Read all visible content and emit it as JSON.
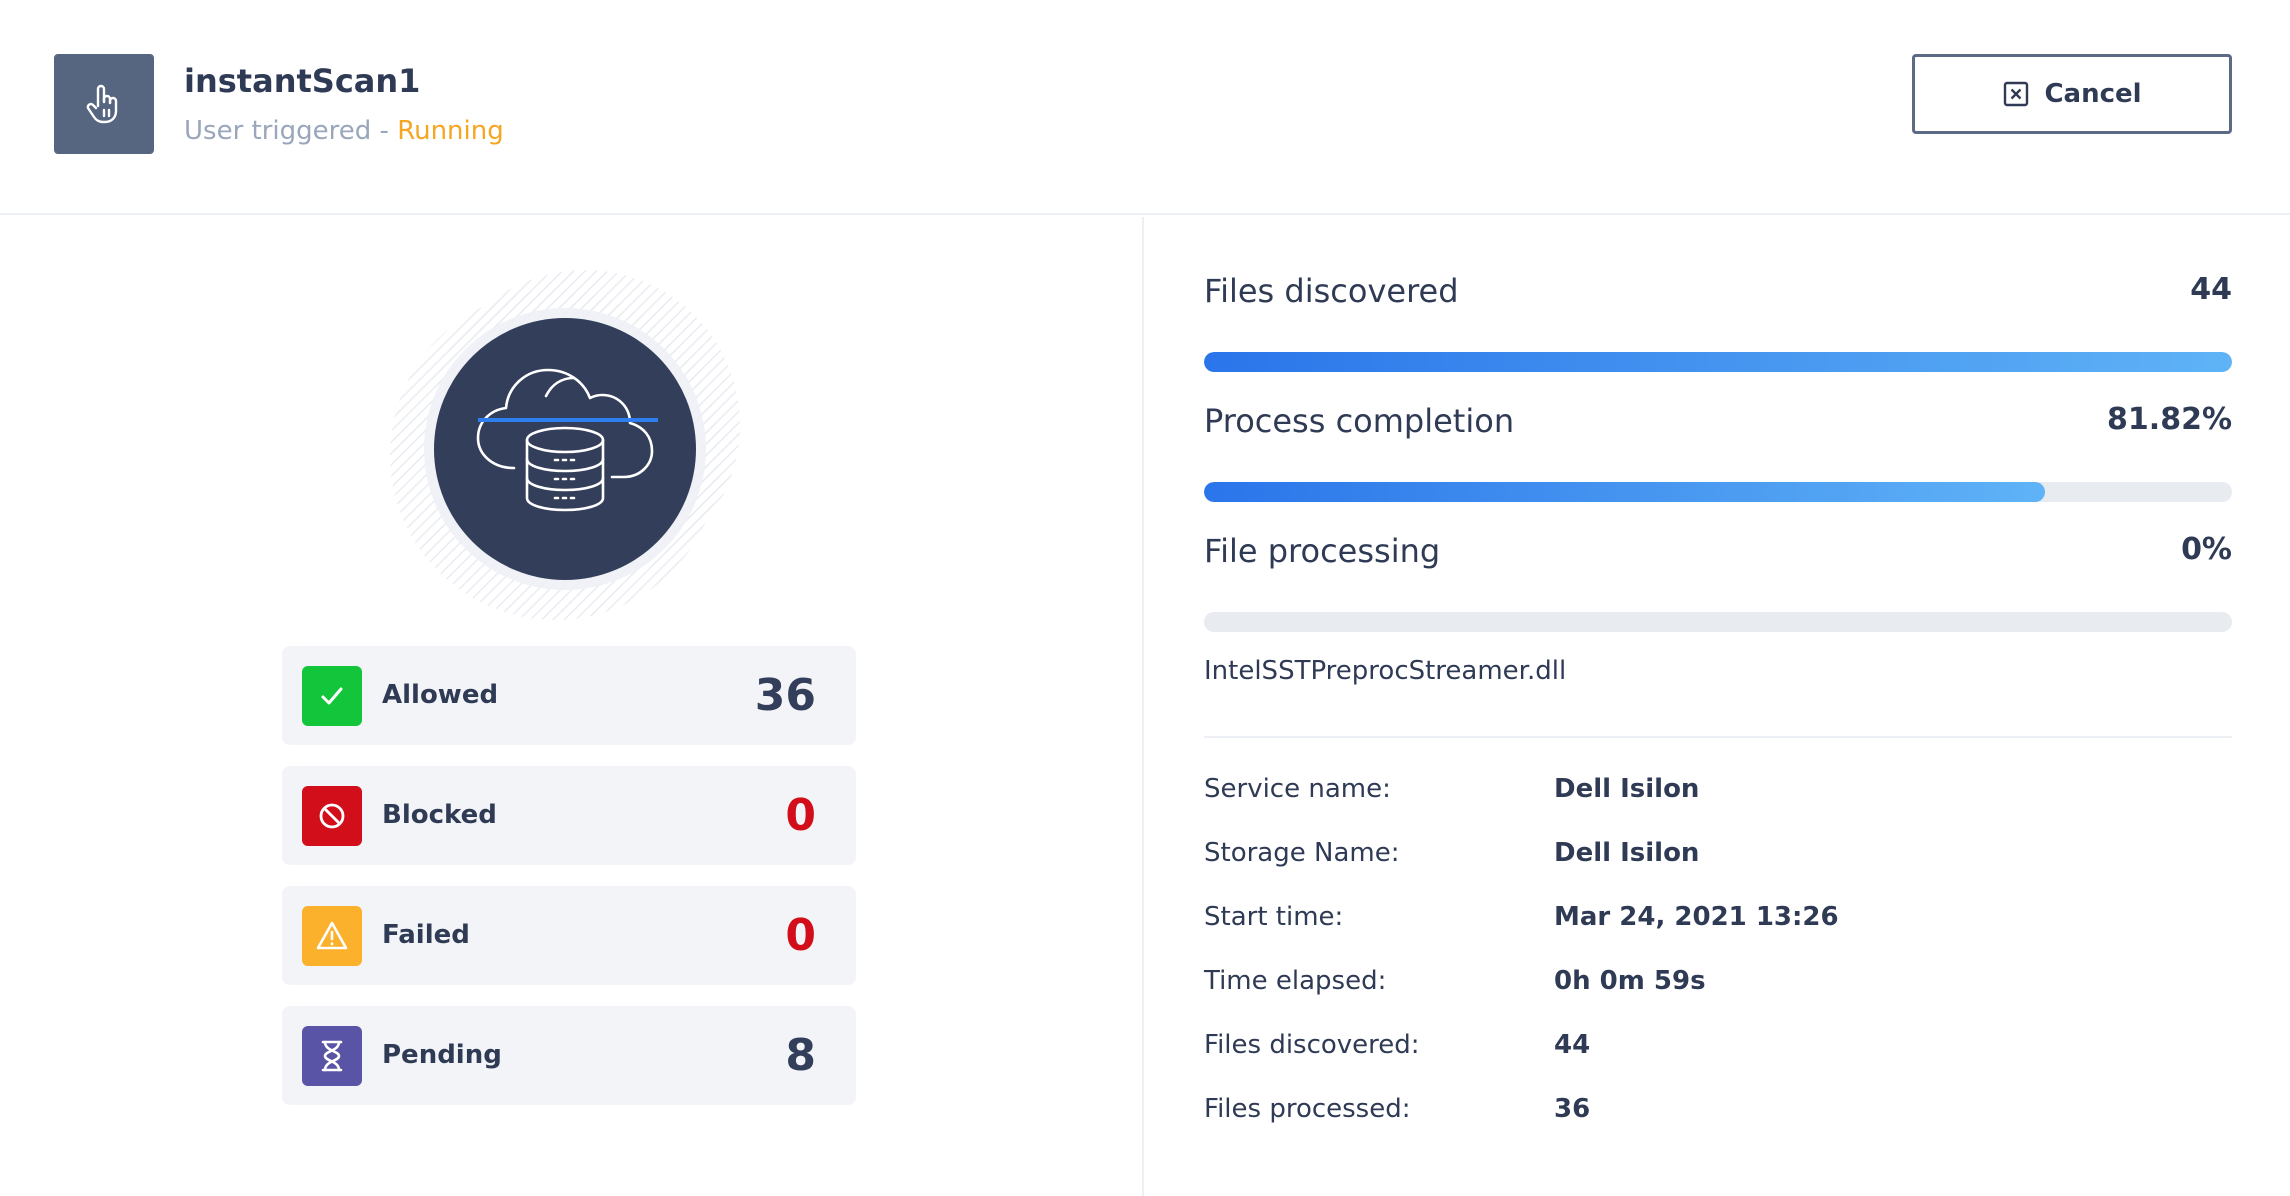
{
  "header": {
    "title": "instantScan1",
    "trigger": "User triggered",
    "separator": " - ",
    "status": "Running",
    "icon": "hand-pointer-icon",
    "cancel_label": "Cancel",
    "cancel_icon": "close-box-icon"
  },
  "hero": {
    "icon": "cloud-database-scan-icon"
  },
  "stats": [
    {
      "label": "Allowed",
      "value": "36",
      "icon": "check-icon",
      "color": "#12c53b"
    },
    {
      "label": "Blocked",
      "value": "0",
      "icon": "blocked-icon",
      "color": "#d10e19"
    },
    {
      "label": "Failed",
      "value": "0",
      "icon": "warning-icon",
      "color": "#fbb12c"
    },
    {
      "label": "Pending",
      "value": "8",
      "icon": "hourglass-icon",
      "color": "#5a54a6"
    }
  ],
  "progress": [
    {
      "label": "Files discovered",
      "value": "44",
      "fill_percent": 100
    },
    {
      "label": "Process completion",
      "value": "81.82%",
      "fill_percent": 81.82
    },
    {
      "label": "File processing",
      "value": "0%",
      "fill_percent": 0
    }
  ],
  "current_file": "IntelSSTPreprocStreamer.dll",
  "details": [
    {
      "key": "Service name:",
      "value": "Dell Isilon"
    },
    {
      "key": "Storage Name:",
      "value": "Dell Isilon"
    },
    {
      "key": "Start time:",
      "value": "Mar 24, 2021 13:26"
    },
    {
      "key": "Time elapsed:",
      "value": "0h 0m 59s"
    },
    {
      "key": "Files discovered:",
      "value": "44"
    },
    {
      "key": "Files processed:",
      "value": "36"
    }
  ],
  "colors": {
    "accent_blue": "#2a75ea",
    "running": "#f5a623",
    "dark_navy": "#333e5a"
  }
}
